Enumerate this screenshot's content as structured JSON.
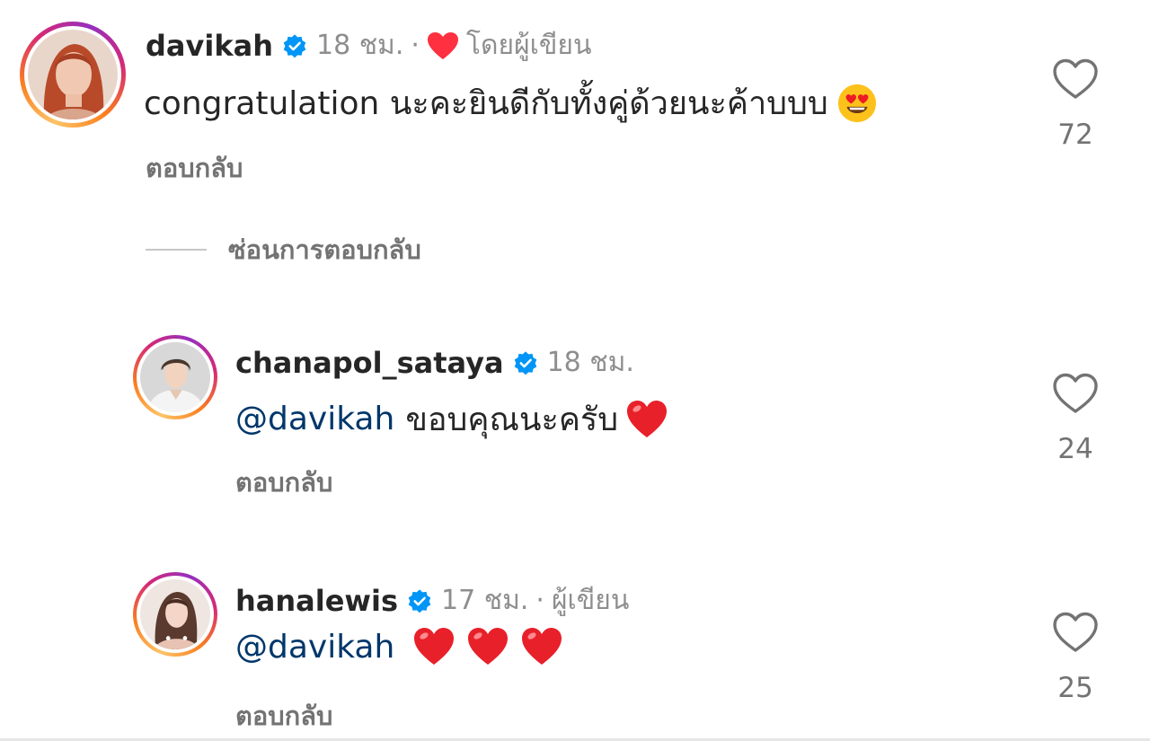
{
  "comments": [
    {
      "username": "davikah",
      "time": "18 ชม.",
      "separator": "·",
      "author_tag": "โดยผู้เขียน",
      "text": "congratulation นะคะยินดีกับทั้งคู่ด้วยนะค้าบบบ",
      "emoji": "heart-eyes-emoji",
      "reply_label": "ตอบกลับ",
      "likes": "72"
    },
    {
      "username": "chanapol_sataya",
      "time": "18 ชม.",
      "mention": "@davikah",
      "text": "ขอบคุณนะครับ",
      "emoji": "red-heart-emoji",
      "reply_label": "ตอบกลับ",
      "likes": "24"
    },
    {
      "username": "hanalewis",
      "time": "17 ชม.",
      "separator": "·",
      "author_tag": "ผู้เขียน",
      "mention": "@davikah",
      "emoji": "red-heart-emoji",
      "emoji_count": 3,
      "reply_label": "ตอบกลับ",
      "likes": "25"
    }
  ],
  "hide_replies_label": "ซ่อนการตอบกลับ",
  "colors": {
    "verified": "#0095f6",
    "mention": "#00376b",
    "muted": "#8e8e8e",
    "liked_heart": "#ff3040"
  }
}
